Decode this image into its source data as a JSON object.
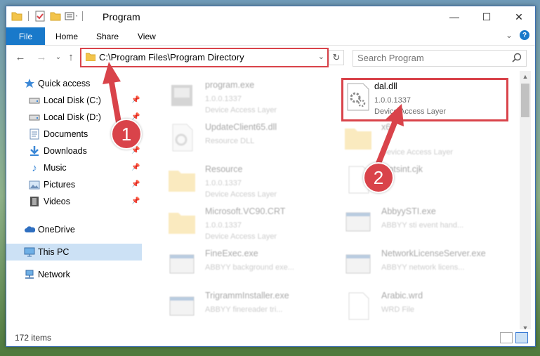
{
  "window": {
    "title": "Program"
  },
  "ribbon": {
    "file": "File",
    "tabs": [
      "Home",
      "Share",
      "View"
    ]
  },
  "nav": {
    "address_path": "C:\\Program Files\\Program Directory",
    "search_placeholder": "Search Program"
  },
  "sidebar": {
    "quick_access": "Quick access",
    "items": [
      {
        "label": "Local Disk (C:)",
        "icon": "drive-icon"
      },
      {
        "label": "Local Disk (D:)",
        "icon": "drive-icon"
      },
      {
        "label": "Documents",
        "icon": "documents-icon"
      },
      {
        "label": "Downloads",
        "icon": "downloads-icon"
      },
      {
        "label": "Music",
        "icon": "music-icon"
      },
      {
        "label": "Pictures",
        "icon": "pictures-icon"
      },
      {
        "label": "Videos",
        "icon": "videos-icon"
      }
    ],
    "onedrive": "OneDrive",
    "this_pc": "This PC",
    "network": "Network"
  },
  "files": [
    {
      "name": "program.exe",
      "meta1": "1.0.0.1337",
      "meta2": "Device Access Layer",
      "icon": "exe-icon"
    },
    {
      "name": "dal.dll",
      "meta1": "1.0.0.1337",
      "meta2": "Device Access Layer",
      "icon": "dll-icon"
    },
    {
      "name": "UpdateClient65.dll",
      "meta1": "Resource DLL",
      "meta2": "",
      "icon": "dll-icon"
    },
    {
      "name": "x64",
      "meta1": "",
      "meta2": "Device Access Layer",
      "icon": "folder-icon"
    },
    {
      "name": "Resource",
      "meta1": "1.0.0.1337",
      "meta2": "Device Access Layer",
      "icon": "folder-icon"
    },
    {
      "name": "fontsint.cjk",
      "meta1": "",
      "meta2": "",
      "icon": "file-icon"
    },
    {
      "name": "Microsoft.VC90.CRT",
      "meta1": "1.0.0.1337",
      "meta2": "Device Access Layer",
      "icon": "folder-icon"
    },
    {
      "name": "AbbyySTI.exe",
      "meta1": "ABBYY sti event hand...",
      "meta2": "",
      "icon": "exe-icon"
    },
    {
      "name": "FineExec.exe",
      "meta1": "ABBYY background exe...",
      "meta2": "",
      "icon": "exe-icon"
    },
    {
      "name": "NetworkLicenseServer.exe",
      "meta1": "ABBYY network licens...",
      "meta2": "",
      "icon": "exe-icon"
    },
    {
      "name": "TrigrammInstaller.exe",
      "meta1": "ABBYY finereader tri...",
      "meta2": "",
      "icon": "exe-icon"
    },
    {
      "name": "Arabic.wrd",
      "meta1": "WRD File",
      "meta2": "",
      "icon": "file-icon"
    }
  ],
  "status": {
    "item_count": "172 items"
  },
  "annotations": {
    "step1": "1",
    "step2": "2"
  },
  "colors": {
    "accent": "#1979ca",
    "highlight": "#d9434a"
  }
}
